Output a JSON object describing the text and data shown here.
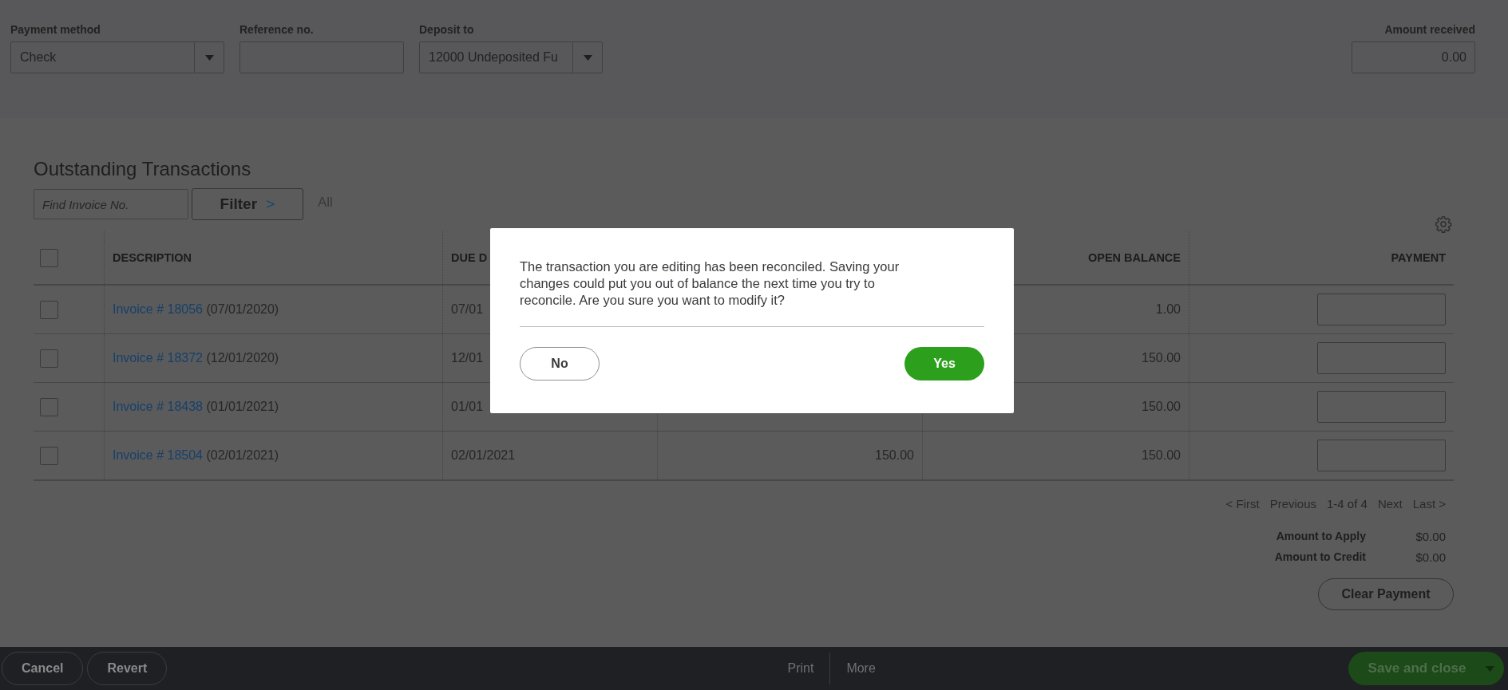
{
  "header_fields": [
    {
      "kind": "dropdown",
      "label": "Payment method",
      "value": "Check"
    },
    {
      "kind": "text",
      "label": "Reference no."
    },
    {
      "kind": "dropdown",
      "label": "Deposit to",
      "value": "12000 Undeposited Fu"
    }
  ],
  "amount_received": {
    "label": "Amount received",
    "value": "0.00"
  },
  "section_title": "Outstanding Transactions",
  "search": {
    "placeholder": "Find Invoice No."
  },
  "filter_button": {
    "label": "Filter",
    "icon": ">"
  },
  "filter_summary": "All",
  "table": {
    "select_all_checked": false,
    "columns": [
      "DESCRIPTION",
      "DUE D",
      "",
      "OPEN BALANCE",
      "PAYMENT"
    ],
    "rows": [
      {
        "checked": false,
        "link": "Invoice # 18056",
        "date": "(07/01/2020)",
        "due_date": "07/01",
        "column_3": "",
        "open_balance": "1.00"
      },
      {
        "checked": false,
        "link": "Invoice # 18372",
        "date": "(12/01/2020)",
        "due_date": "12/01",
        "column_3": "",
        "open_balance": "150.00"
      },
      {
        "checked": false,
        "link": "Invoice # 18438",
        "date": "(01/01/2021)",
        "due_date": "01/01",
        "column_3": "",
        "open_balance": "150.00"
      },
      {
        "checked": false,
        "link": "Invoice # 18504",
        "date": "(02/01/2021)",
        "due_date": "02/01/2021",
        "column_3": "150.00",
        "open_balance": "150.00"
      }
    ]
  },
  "pagination": {
    "first": "< First",
    "previous": "Previous",
    "range": "1-4 of 4",
    "next": "Next",
    "last": "Last >"
  },
  "totals": [
    {
      "label": "Amount to Apply",
      "value": "$0.00"
    },
    {
      "label": "Amount to Credit",
      "value": "$0.00"
    }
  ],
  "clear_button": "Clear Payment",
  "footer": {
    "left": [
      "Cancel",
      "Revert"
    ],
    "center": [
      "Print",
      "More"
    ],
    "save": "Save and close"
  },
  "dialog": {
    "message": "The transaction you are editing has been reconciled. Saving your changes could put you out of balance the next time you try to reconcile. Are you sure you want to modify it?",
    "buttons": [
      {
        "kind": "secondary",
        "label": "No"
      },
      {
        "kind": "primary",
        "label": "Yes"
      }
    ]
  }
}
